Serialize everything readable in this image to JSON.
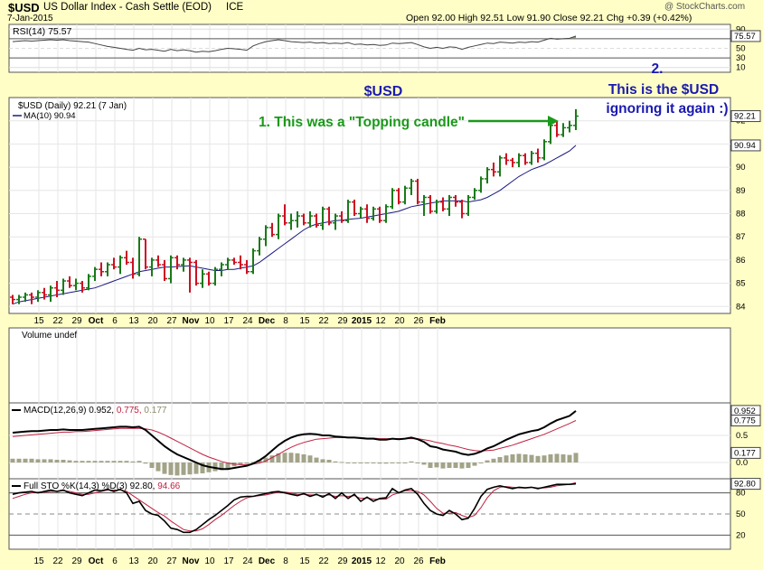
{
  "header": {
    "symbol": "$USD",
    "name": "US Dollar Index - Cash Settle (EOD)",
    "exchange": "ICE",
    "date": "7-Jan-2015",
    "watermark": "@ StockCharts.com",
    "ohlc": "Open 92.00   High 92.51   Low 91.90   Close 92.21   Chg +0.39 (+0.42%)"
  },
  "panels": {
    "rsi_label": "RSI(14) 75.57",
    "price_label": "$USD (Daily) 92.21 (7 Jan)",
    "ma_label": "MA(10) 90.94",
    "volume_label": "Volume undef",
    "macd_label": "MACD(12,26,9) 0.952, ",
    "macd_signal_text": "0.775, ",
    "macd_hist_text": "0.177",
    "sto_label": "Full STO %K(14,3) %D(3) 92.80, ",
    "sto_d_text": "94.66"
  },
  "annotations": {
    "title": "$USD",
    "note1": "1. This was a \"Topping candle\"",
    "note2_line1": "2.",
    "note2_line2": "This is the $USD",
    "note2_line3": "ignoring it again  :)"
  },
  "colors": {
    "background": "#fefec6",
    "panel_bg": "#ffffff",
    "up_bar": "#1a7a1a",
    "down_bar": "#cc1122",
    "ma_line": "#1a1a80",
    "annotation_green": "#1a9a1a",
    "annotation_blue": "#1a1ab0"
  },
  "x_axis_labels": [
    "15",
    "22",
    "29",
    "Oct",
    "6",
    "13",
    "20",
    "27",
    "Nov",
    "10",
    "17",
    "24",
    "Dec",
    "8",
    "15",
    "22",
    "29",
    "2015",
    "12",
    "20",
    "26",
    "Feb"
  ],
  "chart_data": [
    {
      "type": "ohlc",
      "name": "price",
      "ylim": [
        83.7,
        93.0
      ],
      "y_ticks": [
        84,
        85,
        86,
        87,
        88,
        89,
        90,
        91,
        92
      ],
      "last_labels": [
        "92.21",
        "90.94"
      ],
      "ohlc": [
        [
          84.4,
          84.5,
          84.1,
          84.3
        ],
        [
          84.3,
          84.5,
          84.1,
          84.4
        ],
        [
          84.4,
          84.6,
          84.2,
          84.5
        ],
        [
          84.5,
          84.6,
          84.1,
          84.4
        ],
        [
          84.4,
          84.7,
          84.2,
          84.6
        ],
        [
          84.6,
          84.8,
          84.3,
          84.5
        ],
        [
          84.5,
          84.9,
          84.2,
          84.8
        ],
        [
          84.8,
          85.1,
          84.4,
          84.7
        ],
        [
          84.7,
          85.2,
          84.5,
          85.1
        ],
        [
          85.1,
          85.3,
          84.8,
          84.9
        ],
        [
          84.9,
          85.2,
          84.7,
          85.0
        ],
        [
          85.0,
          85.1,
          84.6,
          84.8
        ],
        [
          84.8,
          85.4,
          84.7,
          85.3
        ],
        [
          85.3,
          85.7,
          85.1,
          85.6
        ],
        [
          85.6,
          85.9,
          85.3,
          85.5
        ],
        [
          85.5,
          85.9,
          85.3,
          85.8
        ],
        [
          85.8,
          86.1,
          85.6,
          85.7
        ],
        [
          85.7,
          86.2,
          85.4,
          86.1
        ],
        [
          86.1,
          86.4,
          85.8,
          85.9
        ],
        [
          85.9,
          86.1,
          85.2,
          85.4
        ],
        [
          85.4,
          87.0,
          85.3,
          86.9
        ],
        [
          86.9,
          86.9,
          85.6,
          85.7
        ],
        [
          85.7,
          86.1,
          85.3,
          86.0
        ],
        [
          86.0,
          86.2,
          85.7,
          85.8
        ],
        [
          85.8,
          86.0,
          85.1,
          85.2
        ],
        [
          85.2,
          86.2,
          85.0,
          86.1
        ],
        [
          86.1,
          86.2,
          85.6,
          85.8
        ],
        [
          85.8,
          86.1,
          85.5,
          86.0
        ],
        [
          86.0,
          86.1,
          84.6,
          85.9
        ],
        [
          85.9,
          86.0,
          84.9,
          85.0
        ],
        [
          85.0,
          85.6,
          84.8,
          85.4
        ],
        [
          85.4,
          85.5,
          84.9,
          85.0
        ],
        [
          85.0,
          85.7,
          84.9,
          85.6
        ],
        [
          85.6,
          85.9,
          85.3,
          85.8
        ],
        [
          85.8,
          86.1,
          85.6,
          86.0
        ],
        [
          86.0,
          86.1,
          85.8,
          85.9
        ],
        [
          85.9,
          86.2,
          85.6,
          85.8
        ],
        [
          85.8,
          86.0,
          85.4,
          85.5
        ],
        [
          85.5,
          86.5,
          85.4,
          86.4
        ],
        [
          86.4,
          87.0,
          86.2,
          86.9
        ],
        [
          86.9,
          87.5,
          86.6,
          87.4
        ],
        [
          87.4,
          87.6,
          87.0,
          87.1
        ],
        [
          87.1,
          88.0,
          86.9,
          87.9
        ],
        [
          87.9,
          88.4,
          87.5,
          87.6
        ],
        [
          87.6,
          88.0,
          87.3,
          87.7
        ],
        [
          87.7,
          88.1,
          87.4,
          87.9
        ],
        [
          87.9,
          88.0,
          87.5,
          87.6
        ],
        [
          87.6,
          88.1,
          87.4,
          87.9
        ],
        [
          87.9,
          88.0,
          87.4,
          87.5
        ],
        [
          87.5,
          88.3,
          87.3,
          88.2
        ],
        [
          88.2,
          88.3,
          87.5,
          87.6
        ],
        [
          87.6,
          88.0,
          87.3,
          87.9
        ],
        [
          87.9,
          88.1,
          87.6,
          87.7
        ],
        [
          87.7,
          88.6,
          87.6,
          88.5
        ],
        [
          88.5,
          88.6,
          87.9,
          88.0
        ],
        [
          88.0,
          88.3,
          87.8,
          88.2
        ],
        [
          88.2,
          88.4,
          87.6,
          87.8
        ],
        [
          87.8,
          88.3,
          87.7,
          88.2
        ],
        [
          88.2,
          88.3,
          87.6,
          87.7
        ],
        [
          87.7,
          88.4,
          87.6,
          88.3
        ],
        [
          88.3,
          89.1,
          88.2,
          89.0
        ],
        [
          89.0,
          89.1,
          88.4,
          88.5
        ],
        [
          88.5,
          89.2,
          88.4,
          89.1
        ],
        [
          89.1,
          89.5,
          88.8,
          89.4
        ],
        [
          89.4,
          89.5,
          88.4,
          88.5
        ],
        [
          88.5,
          88.8,
          87.9,
          88.7
        ],
        [
          88.7,
          88.8,
          88.0,
          88.1
        ],
        [
          88.1,
          88.6,
          88.0,
          88.5
        ],
        [
          88.5,
          88.7,
          88.1,
          88.2
        ],
        [
          88.2,
          88.8,
          87.9,
          88.7
        ],
        [
          88.7,
          88.8,
          88.3,
          88.5
        ],
        [
          88.5,
          88.6,
          87.8,
          88.0
        ],
        [
          88.0,
          88.8,
          87.9,
          88.7
        ],
        [
          88.7,
          89.1,
          88.6,
          89.0
        ],
        [
          89.0,
          89.6,
          88.9,
          89.5
        ],
        [
          89.5,
          90.0,
          89.3,
          89.9
        ],
        [
          89.9,
          90.2,
          89.6,
          89.8
        ],
        [
          89.8,
          90.5,
          89.6,
          90.4
        ],
        [
          90.4,
          90.6,
          90.1,
          90.3
        ],
        [
          90.3,
          90.4,
          90.0,
          90.2
        ],
        [
          90.2,
          90.6,
          90.0,
          90.5
        ],
        [
          90.5,
          90.6,
          90.1,
          90.2
        ],
        [
          90.2,
          90.7,
          90.1,
          90.6
        ],
        [
          90.6,
          90.8,
          90.2,
          90.4
        ],
        [
          90.4,
          91.2,
          90.3,
          91.1
        ],
        [
          91.1,
          91.9,
          91.0,
          91.8
        ],
        [
          91.8,
          92.0,
          91.3,
          91.4
        ],
        [
          91.4,
          91.9,
          91.3,
          91.7
        ],
        [
          91.7,
          92.0,
          91.5,
          91.8
        ],
        [
          91.8,
          92.5,
          91.6,
          92.2
        ]
      ],
      "ma10": [
        84.1,
        84.2,
        84.25,
        84.3,
        84.35,
        84.4,
        84.45,
        84.5,
        84.55,
        84.6,
        84.65,
        84.7,
        84.75,
        84.8,
        84.9,
        85.0,
        85.1,
        85.2,
        85.3,
        85.4,
        85.5,
        85.55,
        85.6,
        85.65,
        85.7,
        85.7,
        85.72,
        85.74,
        85.75,
        85.7,
        85.65,
        85.6,
        85.55,
        85.55,
        85.6,
        85.6,
        85.65,
        85.7,
        85.75,
        85.9,
        86.1,
        86.3,
        86.5,
        86.7,
        86.9,
        87.1,
        87.3,
        87.45,
        87.55,
        87.6,
        87.65,
        87.7,
        87.72,
        87.75,
        87.78,
        87.8,
        87.85,
        87.9,
        87.95,
        88.0,
        88.05,
        88.1,
        88.2,
        88.3,
        88.35,
        88.4,
        88.45,
        88.5,
        88.55,
        88.55,
        88.55,
        88.55,
        88.5,
        88.55,
        88.6,
        88.7,
        88.85,
        89.0,
        89.2,
        89.4,
        89.6,
        89.75,
        89.9,
        90.0,
        90.1,
        90.25,
        90.4,
        90.55,
        90.7,
        90.94
      ]
    },
    {
      "type": "line",
      "name": "RSI(14)",
      "ylim": [
        0,
        100
      ],
      "y_ticks": [
        90,
        70,
        50,
        30,
        10
      ],
      "last_label": "75.57",
      "values": [
        64,
        65,
        66,
        65,
        66,
        67,
        68,
        67,
        68,
        66,
        65,
        64,
        63,
        60,
        57,
        54,
        52,
        50,
        48,
        46,
        50,
        47,
        48,
        46,
        44,
        48,
        45,
        47,
        45,
        42,
        44,
        43,
        45,
        48,
        50,
        49,
        48,
        46,
        55,
        60,
        64,
        66,
        68,
        66,
        64,
        63,
        62,
        63,
        61,
        62,
        60,
        61,
        60,
        62,
        58,
        59,
        57,
        58,
        56,
        57,
        61,
        60,
        61,
        62,
        58,
        53,
        50,
        52,
        50,
        53,
        52,
        48,
        52,
        55,
        58,
        61,
        60,
        63,
        62,
        61,
        63,
        62,
        64,
        63,
        67,
        71,
        69,
        70,
        71,
        75.57
      ]
    },
    {
      "type": "line",
      "name": "MACD(12,26,9)",
      "ylim": [
        -0.3,
        1.1
      ],
      "y_ticks": [
        0.5,
        0.0
      ],
      "last_labels": [
        "0.952",
        "0.775",
        "0.177"
      ],
      "macd": [
        0.55,
        0.56,
        0.57,
        0.58,
        0.58,
        0.59,
        0.6,
        0.6,
        0.61,
        0.6,
        0.6,
        0.6,
        0.61,
        0.62,
        0.63,
        0.64,
        0.65,
        0.66,
        0.66,
        0.65,
        0.66,
        0.6,
        0.5,
        0.4,
        0.3,
        0.22,
        0.15,
        0.1,
        0.05,
        0.0,
        -0.05,
        -0.08,
        -0.1,
        -0.12,
        -0.12,
        -0.1,
        -0.08,
        -0.06,
        -0.02,
        0.04,
        0.12,
        0.22,
        0.32,
        0.4,
        0.46,
        0.5,
        0.52,
        0.53,
        0.52,
        0.5,
        0.5,
        0.48,
        0.47,
        0.46,
        0.46,
        0.45,
        0.44,
        0.44,
        0.42,
        0.42,
        0.44,
        0.43,
        0.44,
        0.46,
        0.43,
        0.38,
        0.3,
        0.28,
        0.24,
        0.22,
        0.2,
        0.16,
        0.14,
        0.16,
        0.2,
        0.26,
        0.3,
        0.36,
        0.42,
        0.47,
        0.52,
        0.55,
        0.58,
        0.6,
        0.65,
        0.72,
        0.78,
        0.82,
        0.86,
        0.952
      ],
      "signal": [
        0.48,
        0.49,
        0.5,
        0.51,
        0.52,
        0.53,
        0.54,
        0.55,
        0.56,
        0.56,
        0.57,
        0.57,
        0.58,
        0.59,
        0.6,
        0.61,
        0.62,
        0.63,
        0.63,
        0.63,
        0.63,
        0.62,
        0.6,
        0.56,
        0.51,
        0.45,
        0.39,
        0.33,
        0.27,
        0.21,
        0.15,
        0.1,
        0.06,
        0.02,
        -0.01,
        -0.03,
        -0.04,
        -0.04,
        -0.03,
        -0.01,
        0.03,
        0.09,
        0.15,
        0.22,
        0.28,
        0.33,
        0.37,
        0.4,
        0.43,
        0.44,
        0.45,
        0.46,
        0.46,
        0.46,
        0.46,
        0.46,
        0.45,
        0.45,
        0.44,
        0.44,
        0.44,
        0.44,
        0.44,
        0.44,
        0.44,
        0.42,
        0.4,
        0.37,
        0.35,
        0.32,
        0.3,
        0.27,
        0.24,
        0.22,
        0.21,
        0.22,
        0.23,
        0.26,
        0.29,
        0.32,
        0.36,
        0.4,
        0.44,
        0.48,
        0.52,
        0.57,
        0.62,
        0.67,
        0.72,
        0.775
      ]
    },
    {
      "type": "line",
      "name": "Full STO",
      "ylim": [
        0,
        100
      ],
      "y_ticks": [
        80,
        50,
        20
      ],
      "last_labels": [
        "92.80"
      ],
      "k": [
        78,
        80,
        81,
        82,
        80,
        82,
        84,
        82,
        84,
        80,
        78,
        76,
        80,
        84,
        83,
        85,
        82,
        85,
        80,
        65,
        68,
        55,
        50,
        48,
        40,
        30,
        28,
        24,
        24,
        28,
        35,
        42,
        48,
        55,
        62,
        70,
        74,
        75,
        75,
        77,
        79,
        81,
        82,
        80,
        78,
        76,
        79,
        75,
        78,
        74,
        79,
        72,
        80,
        72,
        78,
        68,
        74,
        68,
        72,
        73,
        86,
        80,
        84,
        86,
        78,
        65,
        55,
        50,
        48,
        55,
        50,
        42,
        44,
        58,
        75,
        85,
        88,
        90,
        88,
        86,
        88,
        87,
        88,
        86,
        88,
        90,
        92,
        92,
        92,
        92.8
      ],
      "d": [
        72,
        75,
        78,
        80,
        81,
        81,
        82,
        82,
        83,
        82,
        80,
        78,
        78,
        80,
        82,
        84,
        84,
        84,
        82,
        76,
        70,
        64,
        58,
        52,
        47,
        40,
        34,
        28,
        26,
        26,
        29,
        35,
        42,
        48,
        55,
        62,
        68,
        73,
        75,
        76,
        77,
        79,
        81,
        81,
        80,
        78,
        78,
        77,
        77,
        76,
        77,
        75,
        76,
        75,
        76,
        72,
        73,
        71,
        71,
        71,
        77,
        80,
        83,
        83,
        82,
        77,
        68,
        58,
        51,
        51,
        52,
        48,
        45,
        48,
        59,
        73,
        83,
        88,
        89,
        88,
        87,
        87,
        88,
        87,
        87,
        88,
        90,
        91,
        92,
        94.66
      ]
    }
  ]
}
